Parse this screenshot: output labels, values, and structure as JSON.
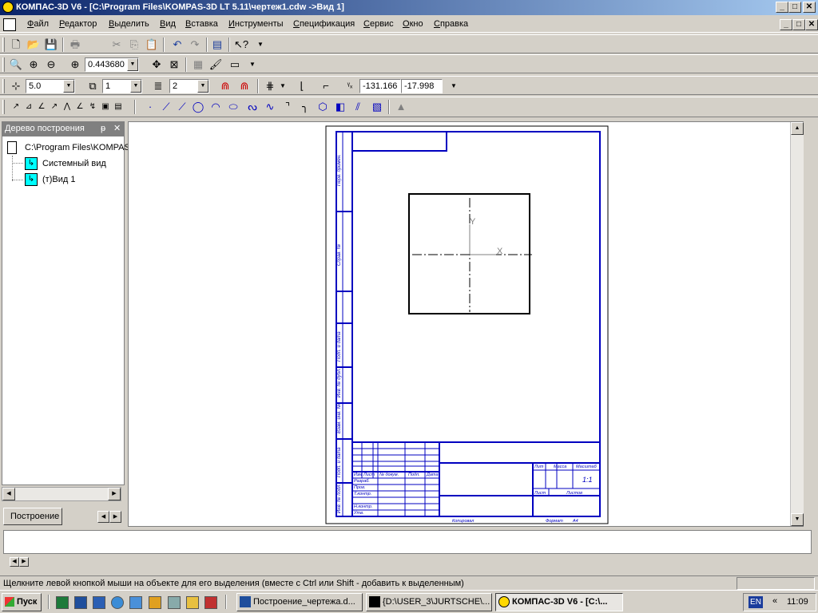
{
  "window": {
    "title": "КОМПАС-3D V6 - [C:\\Program Files\\KOMPAS-3D LT 5.11\\чертеж1.cdw ->Вид 1]"
  },
  "menu": [
    "Файл",
    "Редактор",
    "Выделить",
    "Вид",
    "Вставка",
    "Инструменты",
    "Спецификация",
    "Сервис",
    "Окно",
    "Справка"
  ],
  "toolbar": {
    "zoom_value": "0.443680",
    "step_value": "5.0",
    "view_value": "1",
    "layer_value": "2",
    "coord_x": "-131.166",
    "coord_y": "-17.998"
  },
  "tree": {
    "header": "Дерево построения",
    "pin": "ᵽ",
    "close": "✕",
    "root": "C:\\Program Files\\KOMPAS",
    "items": [
      "Системный вид",
      "(т)Вид 1"
    ],
    "tab": "Построение"
  },
  "drawing": {
    "axis_x": "X",
    "axis_y": "Y",
    "titleblock": {
      "lit": "Лит",
      "massa": "Масса",
      "masshtab": "Масштаб",
      "scale_val": "1:1",
      "list": "Лист",
      "listov": "Листов",
      "kopiroval": "Копировал",
      "format": "Формат",
      "format_val": "A4",
      "izm": "Изм",
      "listcol": "Лист",
      "doc": "№ докум.",
      "podp": "Подп.",
      "data": "Дата",
      "razrab": "Разраб.",
      "prov": "Пров.",
      "tkontr": "Т.контр.",
      "nkontr": "Н.контр.",
      "utv": "Утв.",
      "side_labels": [
        "Перв. примен.",
        "Справ. №",
        "Подп. и дата",
        "Инв. № дубл.",
        "Взам. инв. №",
        "Подп. и дата",
        "Инв. № подл."
      ]
    }
  },
  "statusbar": {
    "text": "Щелкните левой кнопкой мыши на объекте для его выделения (вместе с Ctrl или Shift - добавить к выделенным)"
  },
  "taskbar": {
    "start": "Пуск",
    "tasks": [
      "Построение_чертежа.d...",
      "{D:\\USER_3\\JURTSCHE\\...",
      "КОМПАС-3D V6 - [C:\\..."
    ],
    "lang": "EN",
    "chevron": "«",
    "time": "11:09"
  }
}
